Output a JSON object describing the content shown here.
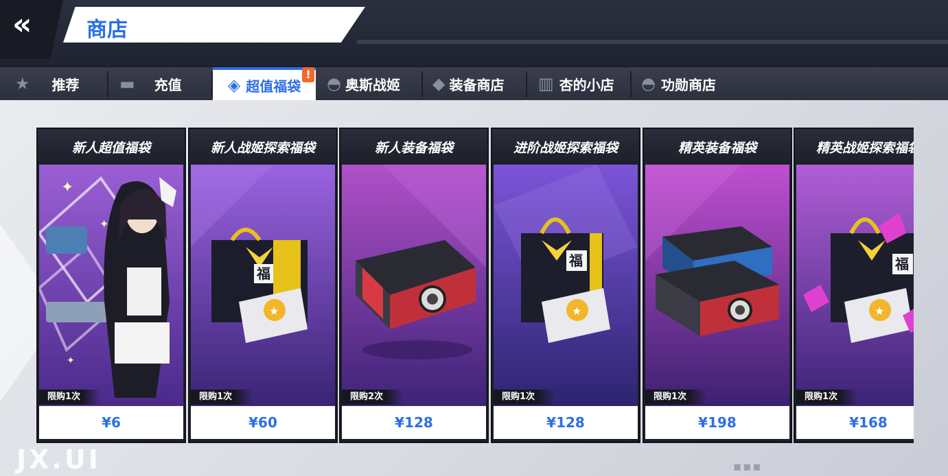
{
  "header": {
    "back_icon": "double-chevron-left-icon",
    "title": "商店"
  },
  "tabs": [
    {
      "label": "推荐",
      "icon": "star-icon",
      "active": false
    },
    {
      "label": "充值",
      "icon": "wallet-icon",
      "active": false
    },
    {
      "label": "超值福袋",
      "icon": "gift-bag-icon",
      "active": true,
      "alert": "!"
    },
    {
      "label": "奥斯战姬",
      "icon": "cap-icon",
      "active": false
    },
    {
      "label": "装备商店",
      "icon": "gear-box-icon",
      "active": false
    },
    {
      "label": "杏的小店",
      "icon": "gift-icon",
      "active": false
    },
    {
      "label": "功勋商店",
      "icon": "cap-icon",
      "active": false
    }
  ],
  "cards": [
    {
      "title": "新人超值福袋",
      "limit": "限购1次",
      "price": "¥6",
      "art": "character"
    },
    {
      "title": "新人战姬探索福袋",
      "limit": "限购1次",
      "price": "¥60",
      "art": "bag-gold"
    },
    {
      "title": "新人装备福袋",
      "limit": "限购2次",
      "price": "¥128",
      "art": "crate-red"
    },
    {
      "title": "进阶战姬探索福袋",
      "limit": "限购1次",
      "price": "¥128",
      "art": "bag-dark"
    },
    {
      "title": "精英装备福袋",
      "limit": "限购1次",
      "price": "¥198",
      "art": "crate-double"
    },
    {
      "title": "精英战姬探索福袋",
      "limit": "限购1次",
      "price": "¥168",
      "art": "bag-gems"
    }
  ],
  "watermark": "JX.UI",
  "colors": {
    "accent": "#2b6fe6",
    "header_bg": "#2b3040",
    "alert": "#f06a2b",
    "card_purple": "#7a3fc7"
  }
}
